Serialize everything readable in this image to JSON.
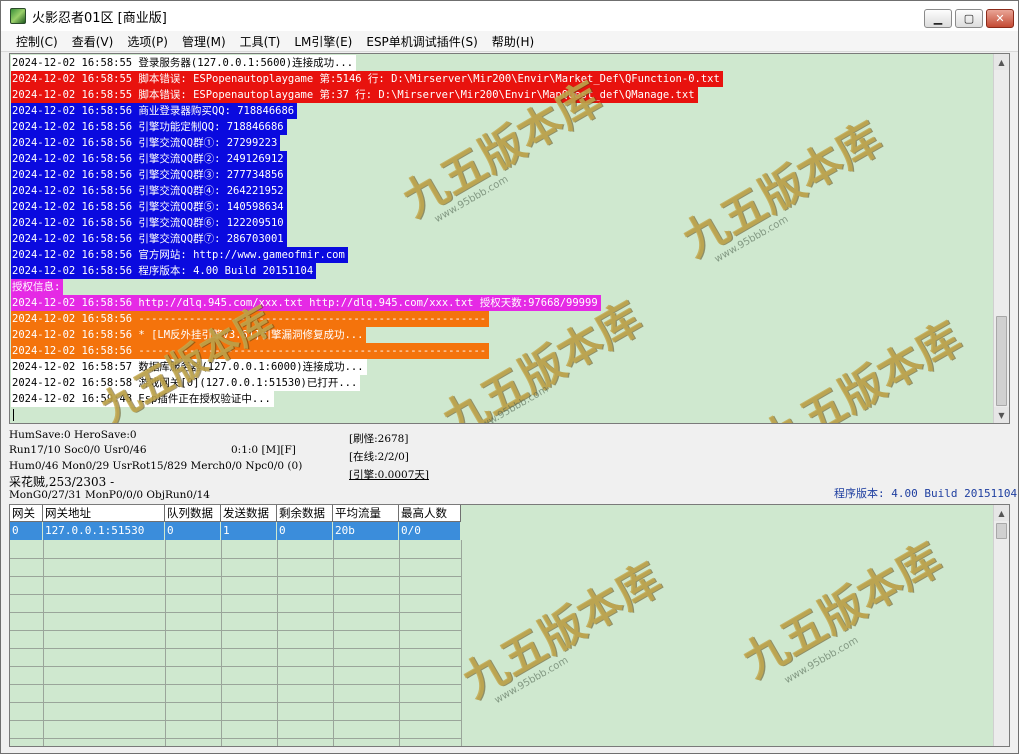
{
  "window": {
    "title": "火影忍者01区 [商业版]",
    "minimize_label": "▁",
    "maximize_label": "▢",
    "close_label": "✕"
  },
  "menu": [
    {
      "label": "控制(C)"
    },
    {
      "label": "查看(V)"
    },
    {
      "label": "选项(P)"
    },
    {
      "label": "管理(M)"
    },
    {
      "label": "工具(T)"
    },
    {
      "label": "LM引擎(E)"
    },
    {
      "label": "ESP单机调试插件(S)"
    },
    {
      "label": "帮助(H)"
    }
  ],
  "log": [
    {
      "style": "white",
      "text": "2024-12-02 16:58:55 登录服务器(127.0.0.1:5600)连接成功..."
    },
    {
      "style": "red",
      "text": "2024-12-02 16:58:55 脚本错误: ESPopenautoplaygame 第:5146 行: D:\\Mirserver\\Mir200\\Envir\\Market_Def\\QFunction-0.txt"
    },
    {
      "style": "red",
      "text": "2024-12-02 16:58:55 脚本错误: ESPopenautoplaygame 第:37 行: D:\\Mirserver\\Mir200\\Envir\\MapQuest_def\\QManage.txt"
    },
    {
      "style": "blue",
      "text": "2024-12-02 16:58:56 商业登录器购买QQ: 718846686"
    },
    {
      "style": "blue",
      "text": "2024-12-02 16:58:56 引擎功能定制QQ: 718846686"
    },
    {
      "style": "blue",
      "text": "2024-12-02 16:58:56 引擎交流QQ群①: 27299223"
    },
    {
      "style": "blue",
      "text": "2024-12-02 16:58:56 引擎交流QQ群②: 249126912"
    },
    {
      "style": "blue",
      "text": "2024-12-02 16:58:56 引擎交流QQ群③: 277734856"
    },
    {
      "style": "blue",
      "text": "2024-12-02 16:58:56 引擎交流QQ群④: 264221952"
    },
    {
      "style": "blue",
      "text": "2024-12-02 16:58:56 引擎交流QQ群⑤: 140598634"
    },
    {
      "style": "blue",
      "text": "2024-12-02 16:58:56 引擎交流QQ群⑥: 122209510"
    },
    {
      "style": "blue",
      "text": "2024-12-02 16:58:56 引擎交流QQ群⑦: 286703001"
    },
    {
      "style": "blue",
      "text": "2024-12-02 16:58:56 官方网站: http://www.gameofmir.com"
    },
    {
      "style": "blue",
      "text": "2024-12-02 16:58:56 程序版本: 4.00 Build 20151104"
    },
    {
      "style": "magenta",
      "text": "授权信息:"
    },
    {
      "style": "magenta",
      "text": "2024-12-02 16:58:56 http://dlq.945.com/xxx.txt http://dlq.945.com/xxx.txt 授权天数:97668/99999"
    },
    {
      "style": "orange",
      "text": "2024-12-02 16:58:56 -------------------------------------------------------"
    },
    {
      "style": "orange",
      "text": "2024-12-02 16:58:56 * [LM反外挂引擎v3.61]引擎漏洞修复成功..."
    },
    {
      "style": "orange",
      "text": "2024-12-02 16:58:56 -------------------------------------------------------"
    },
    {
      "style": "white",
      "text": "2024-12-02 16:58:57 数据库服务器(127.0.0.1:6000)连接成功..."
    },
    {
      "style": "white",
      "text": "2024-12-02 16:58:58 游戏网关[0](127.0.0.1:51530)已打开..."
    },
    {
      "style": "white",
      "text": "2024-12-02 16:59:48 Esp插件正在授权验证中..."
    }
  ],
  "status": {
    "humsave": "HumSave:0 HeroSave:0",
    "run": "Run17/10 Soc0/0 Usr0/46",
    "time": "0:1:0 [M][F]",
    "hum": "Hum0/46 Mon0/29 UsrRot15/829 Merch0/0 Npc0/0 (0)",
    "map": "采花贼,253/2303 -",
    "mongo": "MonG0/27/31 MonP0/0/0 ObjRun0/14",
    "refresh_monster": "[刷怪:2678]",
    "online": "[在线:2/2/0]",
    "engine": "[引擎:0.0007天]",
    "version": "程序版本: 4.00 Build 20151104"
  },
  "table": {
    "columns": [
      "网关",
      "网关地址",
      "队列数据",
      "发送数据",
      "剩余数据",
      "平均流量",
      "最高人数"
    ],
    "rows": [
      [
        "0",
        "127.0.0.1:51530",
        "0",
        "1",
        "0",
        "20b",
        "0/0"
      ]
    ]
  },
  "watermark": {
    "text": "九五版本库",
    "url": "www.95bbb.com"
  }
}
